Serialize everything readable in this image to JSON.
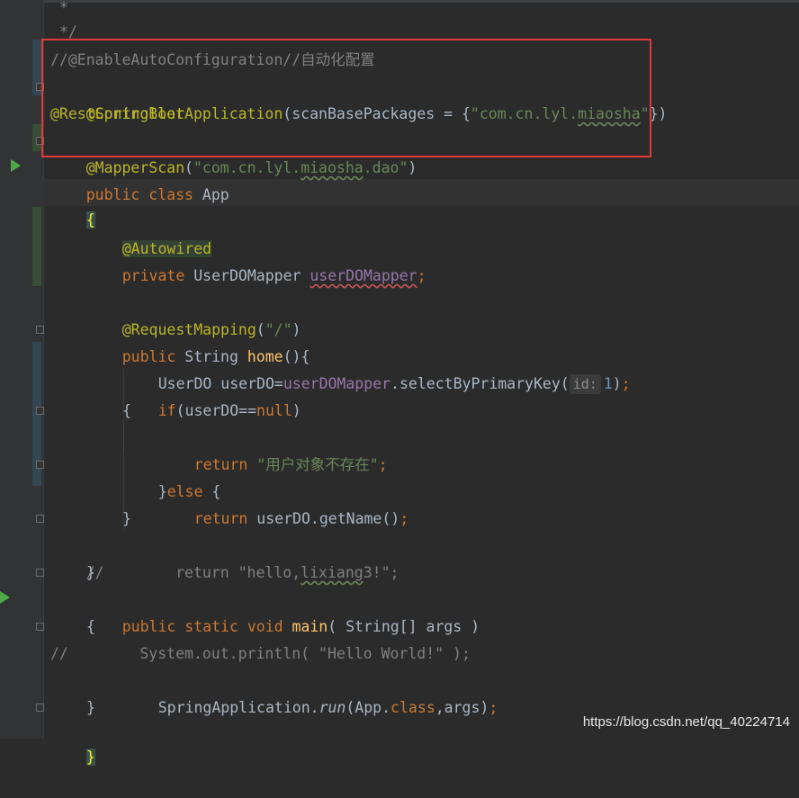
{
  "editor": {
    "lines": {
      "l0": "*",
      "l1": "*/",
      "l2": "//@EnableAutoConfiguration//自动化配置",
      "l3_ann": "@SpringBootApplication",
      "l3_mid": "(scanBasePackages = {",
      "l3_str_a": "\"com.cn.lyl.",
      "l3_str_b": "miaosha",
      "l3_str_c": "\"",
      "l3_end": "})",
      "l4": "@RestController",
      "l5_ann": "@MapperScan",
      "l5_open": "(",
      "l5_str_a": "\"com.cn.lyl.",
      "l5_str_b": "miaosha",
      "l5_str_c": ".dao\"",
      "l5_close": ")",
      "l6_kw": "public class",
      "l6_name": " App",
      "l7": "{",
      "l8": "@Autowired",
      "l9_kw": "private",
      "l9_type": " UserDOMapper ",
      "l9_field": "userDOMapper",
      "l9_semi": ";",
      "l11_ann": "@RequestMapping",
      "l11_open": "(",
      "l11_str": "\"/\"",
      "l11_close": ")",
      "l12_kw": "public",
      "l12_type": " String ",
      "l12_mth": "home",
      "l12_rest": "(){",
      "l13_a": "UserDO userDO=",
      "l13_field": "userDOMapper",
      "l13_b": ".selectByPrimaryKey(",
      "l13_hint": "id:",
      "l13_num": "1",
      "l13_c": ")",
      "l13_semi": ";",
      "l14_kw": "if",
      "l14_a": "(userDO==",
      "l14_null": "null",
      "l14_b": ")",
      "l15": "{",
      "l16_kw": "return",
      "l16_str": " \"用户对象不存在\"",
      "l16_semi": ";",
      "l17_a": "}",
      "l17_kw": "else",
      "l17_b": " {",
      "l18_kw": "return",
      "l18_a": " userDO.getName()",
      "l18_semi": ";",
      "l19": "}",
      "l20_a": "//        return \"hello,",
      "l20_b": "lixiang",
      "l20_c": "3!\";",
      "l21": "}",
      "l22_kw": "public static void",
      "l22_mth": " main",
      "l22_rest": "( String[] args )",
      "l23": "{",
      "l24": "//        System.out.println( \"Hello World!\" );",
      "l25_a": "SpringApplication.",
      "l25_run": "run",
      "l25_b": "(App.",
      "l25_kw": "class",
      "l25_c": ",args)",
      "l25_semi": ";",
      "l26": "}",
      "l27": "}"
    }
  },
  "watermark": "https://blog.csdn.net/qq_40224714",
  "colors": {
    "background": "#2b2b2b",
    "keyword": "#cc7832",
    "annotation": "#bbb529",
    "string": "#6a8759",
    "comment": "#808080",
    "field": "#9876aa",
    "number": "#6897bb",
    "highlight_box": "#e23a3a"
  }
}
